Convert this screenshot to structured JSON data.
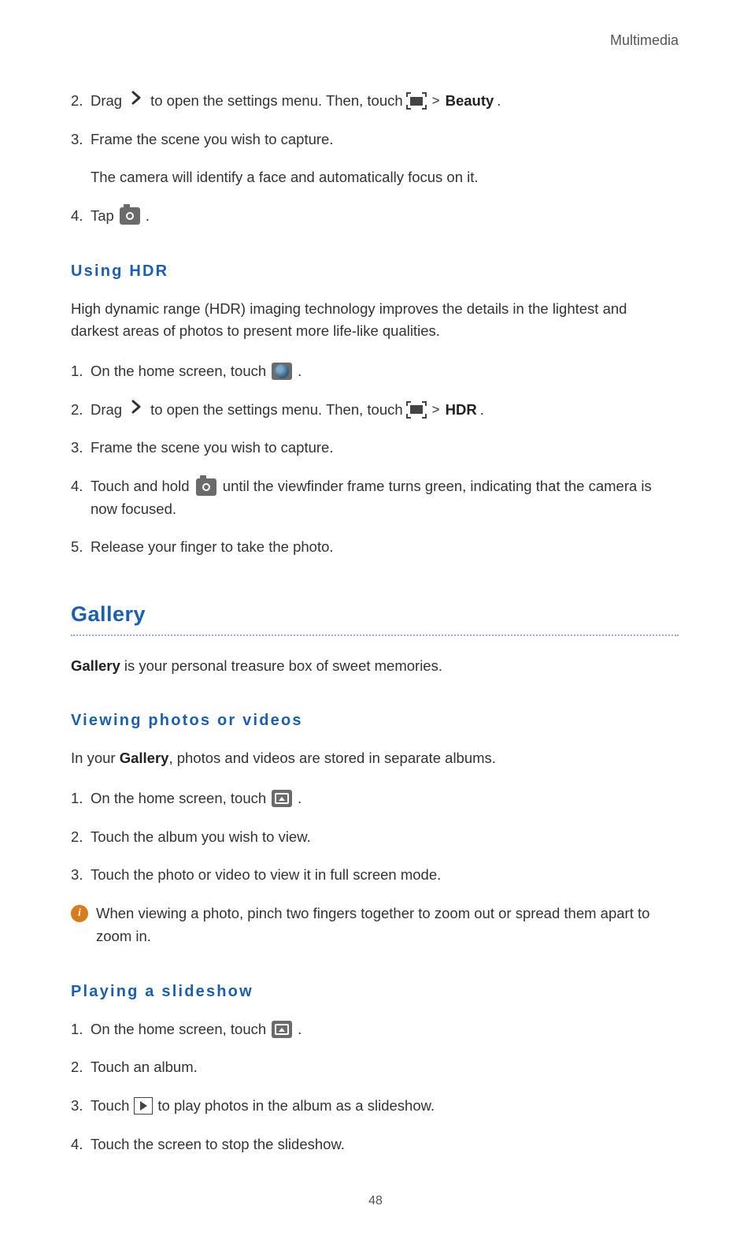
{
  "header": {
    "section": "Multimedia"
  },
  "beauty": {
    "step2a": "2.",
    "step2_drag": "Drag",
    "step2_b": "to open the settings menu. Then, touch",
    "step2_mode": "Beauty",
    "step3a": "3.",
    "step3": "Frame the scene you wish to capture.",
    "step3_sub": "The camera will identify a face and automatically focus on it.",
    "step4a": "4.",
    "step4": "Tap",
    "period": "."
  },
  "hdr": {
    "heading": "Using  HDR",
    "intro": "High dynamic range (HDR) imaging technology improves the details in the lightest and darkest areas of photos to present more life-like qualities.",
    "s1a": "1.",
    "s1": "On the home screen, touch",
    "s2a": "2.",
    "s2_drag": "Drag",
    "s2_b": "to open the settings menu. Then, touch",
    "s2_mode": "HDR",
    "s3a": "3.",
    "s3": "Frame the scene you wish to capture.",
    "s4a": "4.",
    "s4_pre": "Touch and hold",
    "s4_post": "until the viewfinder frame turns green, indicating that the camera is now focused.",
    "s5a": "5.",
    "s5": "Release your finger to take the photo.",
    "period": "."
  },
  "gallery": {
    "heading": "Gallery",
    "intro_bold": "Gallery",
    "intro_rest": " is your personal treasure box of sweet memories."
  },
  "viewing": {
    "heading": "Viewing  photos  or  videos",
    "intro_pre": "In your ",
    "intro_bold": "Gallery",
    "intro_post": ", photos and videos are stored in separate albums.",
    "s1a": "1.",
    "s1": "On the home screen, touch",
    "s2a": "2.",
    "s2": "Touch the album you wish to view.",
    "s3a": "3.",
    "s3": "Touch the photo or video to view it in full screen mode.",
    "tip": "When viewing a photo, pinch two fingers together to zoom out or spread them apart to zoom in.",
    "period": "."
  },
  "slideshow": {
    "heading": "Playing  a  slideshow",
    "s1a": "1.",
    "s1": "On the home screen, touch",
    "s2a": "2.",
    "s2": "Touch an album.",
    "s3a": "3.",
    "s3_pre": "Touch",
    "s3_post": "to play photos in the album as a slideshow.",
    "s4a": "4.",
    "s4": "Touch the screen to stop the slideshow.",
    "period": "."
  },
  "page": "48"
}
